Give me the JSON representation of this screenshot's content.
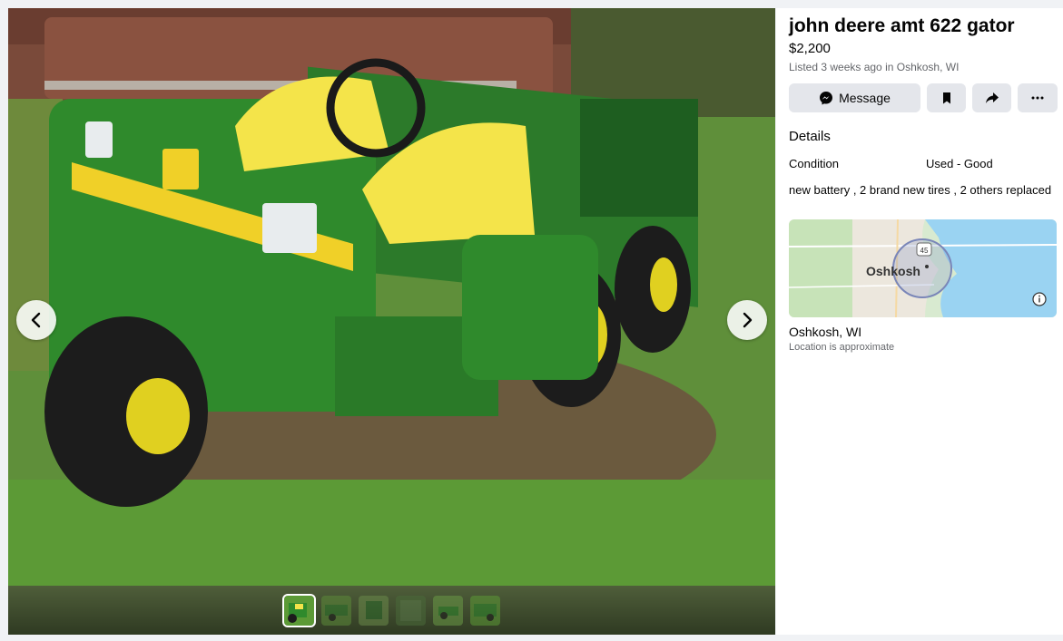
{
  "listing": {
    "title": "john deere amt 622 gator",
    "price": "$2,200",
    "listed": "Listed 3 weeks ago in Oshkosh, WI"
  },
  "actions": {
    "message": "Message",
    "icons": [
      "messenger-icon",
      "bookmark-icon",
      "share-icon",
      "more-icon"
    ]
  },
  "details": {
    "heading": "Details",
    "condition_label": "Condition",
    "condition_value": "Used - Good",
    "description": "new battery , 2 brand new tires , 2 others replaced"
  },
  "map": {
    "city_label": "Oshkosh",
    "route_shield": "45",
    "info_icon": "info-icon"
  },
  "location": {
    "name": "Oshkosh, WI",
    "note": "Location is approximate"
  },
  "gallery": {
    "photo_count": 6,
    "active_index": 0
  },
  "colors": {
    "background": "#f0f2f5",
    "button": "#e4e6eb",
    "secondary_text": "#65676b",
    "deere_green": "#2f8a2c",
    "deere_yellow": "#f0d028",
    "water": "#9ad3f2"
  }
}
